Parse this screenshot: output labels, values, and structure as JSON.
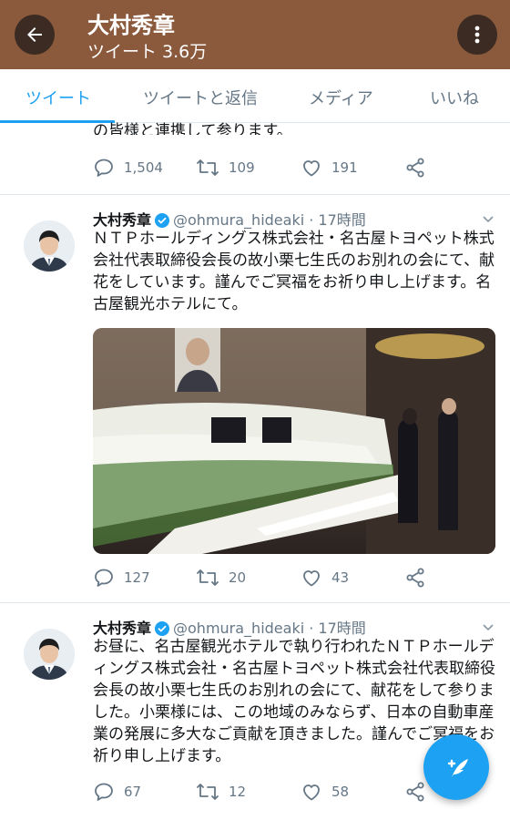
{
  "header": {
    "title": "大村秀章",
    "subtitle": "ツイート 3.6万"
  },
  "tabs": [
    "ツイート",
    "ツイートと返信",
    "メディア",
    "いいね"
  ],
  "partial_tweet": {
    "text": "の皆様と連携して参ります。",
    "replies": "1,504",
    "retweets": "109",
    "likes": "191"
  },
  "tweets": [
    {
      "name": "大村秀章",
      "handle": "@ohmura_hideaki",
      "time": "· 17時間",
      "text": "ＮＴＰホールディングス株式会社・名古屋トヨペット株式会社代表取締役会長の故小栗七生氏のお別れの会にて、献花をしています。謹んでご冥福をお祈り申し上げます。名古屋観光ホテルにて。",
      "replies": "127",
      "retweets": "20",
      "likes": "43"
    },
    {
      "name": "大村秀章",
      "handle": "@ohmura_hideaki",
      "time": "· 17時間",
      "text": "お昼に、名古屋観光ホテルで執り行われたＮＴＰホールディングス株式会社・名古屋トヨペット株式会社代表取締役会長の故小栗七生氏のお別れの会にて、献花をして参りました。小栗様には、この地域のみならず、日本の自動車産業の発展に多大なご貢献を頂きました。謹んでご冥福をお祈り申し上げます。",
      "replies": "67",
      "retweets": "12",
      "likes": "58"
    }
  ],
  "colors": {
    "header_bg": "#8b5a3c",
    "accent": "#1da1f2",
    "muted": "#657786"
  }
}
